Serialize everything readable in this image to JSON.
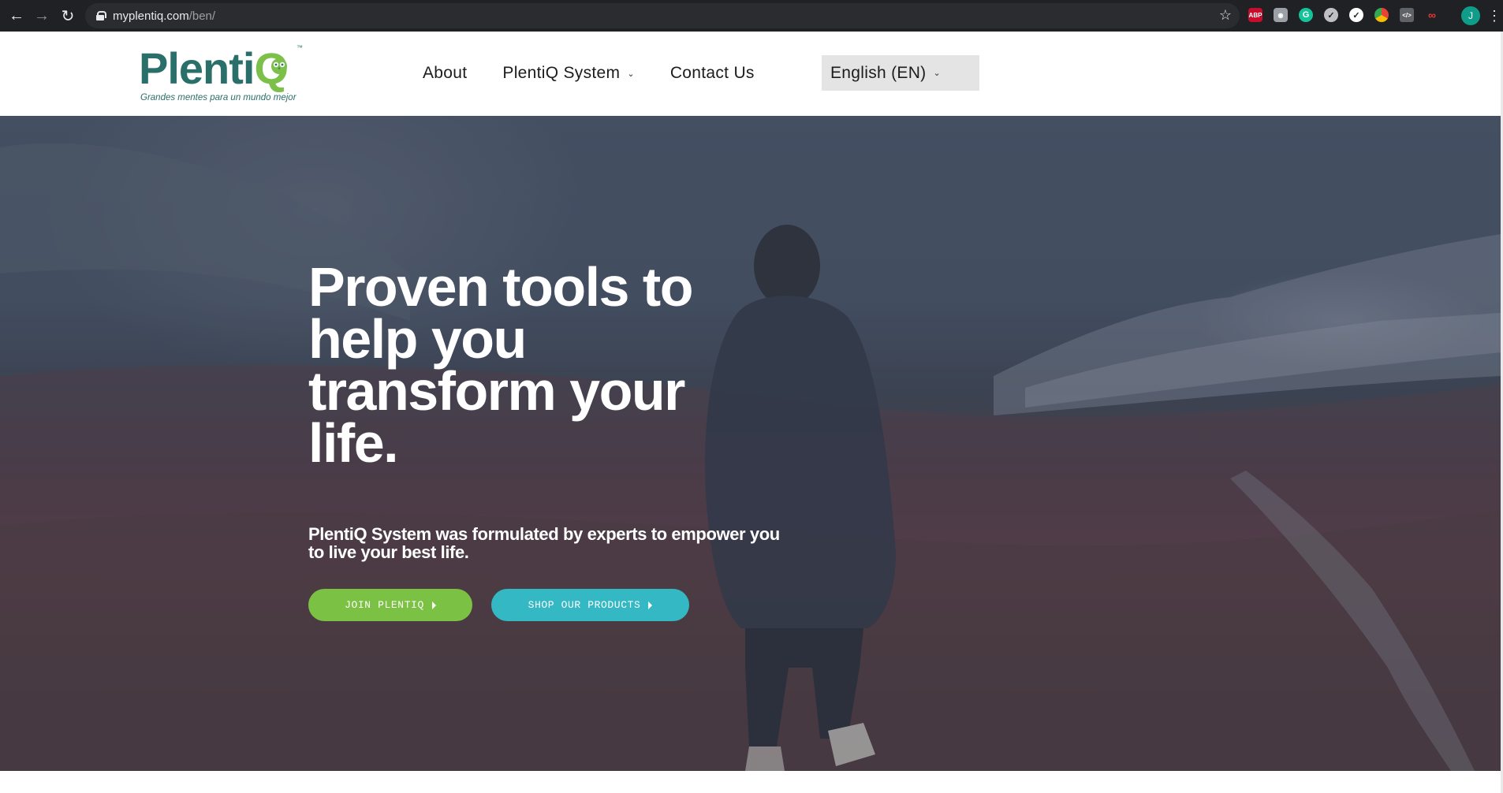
{
  "browser": {
    "url_host": "myplentiq.com",
    "url_path": "/ben/",
    "profile_initial": "J",
    "extensions": [
      "adblock-plus-icon",
      "camera-icon",
      "grammarly-icon",
      "checkmark-extension-icon",
      "color-picker-icon",
      "chrome-circle-icon",
      "code-icon",
      "link-icon"
    ]
  },
  "logo": {
    "brand_main": "Plenti",
    "brand_q": "Q",
    "tm": "™",
    "tagline": "Grandes mentes para un mundo mejor"
  },
  "nav": {
    "about": "About",
    "system": "PlentiQ System",
    "contact": "Contact Us",
    "language": "English (EN)"
  },
  "hero": {
    "title": "Proven tools to help you transform your life.",
    "subtitle": "PlentiQ System was formulated by experts to empower you to live your best life.",
    "join_button": "JOIN PLENTIQ",
    "shop_button": "SHOP OUR PRODUCTS"
  },
  "colors": {
    "brand_teal": "#2a6f6a",
    "brand_green": "#7bc143",
    "shop_teal": "#33b8c4",
    "chrome_bg": "#202124"
  }
}
